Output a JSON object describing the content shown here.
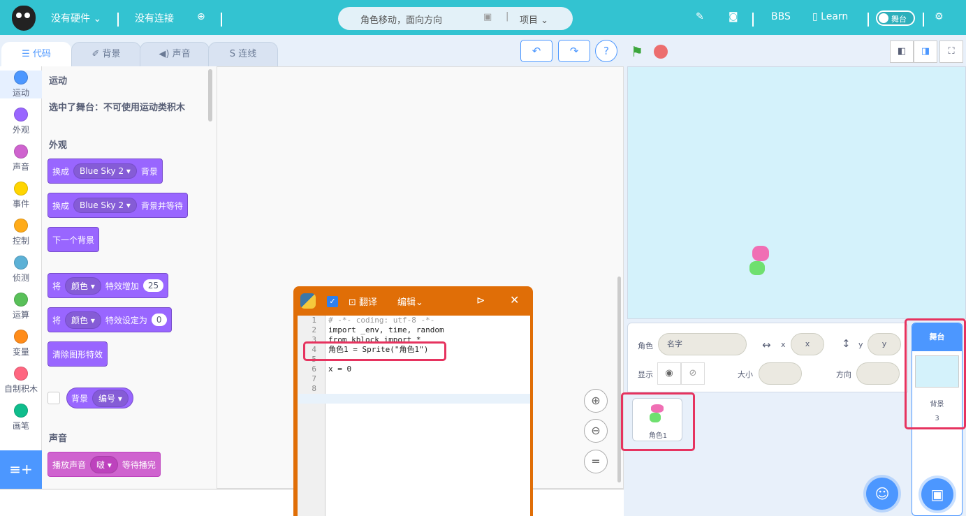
{
  "topbar": {
    "hardware": "没有硬件",
    "connection": "没有连接",
    "project_title": "角色移动，面向方向",
    "project_menu": "项目",
    "bbs": "BBS",
    "learn": "Learn",
    "stage_toggle": "舞台"
  },
  "tabs": [
    {
      "label": "代码"
    },
    {
      "label": "背景"
    },
    {
      "label": "声音"
    },
    {
      "label": "连线"
    }
  ],
  "categories": [
    {
      "label": "运动",
      "color": "#4c97ff"
    },
    {
      "label": "外观",
      "color": "#9966ff"
    },
    {
      "label": "声音",
      "color": "#cf63cf"
    },
    {
      "label": "事件",
      "color": "#ffd500"
    },
    {
      "label": "控制",
      "color": "#ffab19"
    },
    {
      "label": "侦测",
      "color": "#5cb1d6"
    },
    {
      "label": "运算",
      "color": "#59c059"
    },
    {
      "label": "变量",
      "color": "#ff8c1a"
    },
    {
      "label": "自制积木",
      "color": "#ff6680"
    },
    {
      "label": "画笔",
      "color": "#0fbd8c"
    }
  ],
  "palette": {
    "motion_heading": "运动",
    "motion_note": "选中了舞台：不可使用运动类积木",
    "looks_heading": "外观",
    "b1": {
      "a": "换成",
      "menu": "Blue Sky 2",
      "b": "背景"
    },
    "b2": {
      "a": "换成",
      "menu": "Blue Sky 2",
      "b": "背景并等待"
    },
    "b3": "下一个背景",
    "b4": {
      "a": "将",
      "menu": "颜色",
      "b": "特效增加",
      "val": "25"
    },
    "b5": {
      "a": "将",
      "menu": "颜色",
      "b": "特效设定为",
      "val": "0"
    },
    "b6": "清除图形特效",
    "b7": {
      "a": "背景",
      "menu": "编号"
    },
    "sound_heading": "声音",
    "b8": {
      "a": "播放声音",
      "menu": "啵",
      "b": "等待播完"
    }
  },
  "editor": {
    "translate": "翻译",
    "edit_menu": "编辑",
    "checked": true,
    "lines": [
      "# -*- coding: utf-8 -*-",
      "import _env, time, random",
      "from kblock import *",
      "角色1 = Sprite(\"角色1\")",
      "",
      "x = 0",
      "",
      "",
      ""
    ]
  },
  "sprite_info": {
    "sprite_label": "角色",
    "name_placeholder": "名字",
    "x_label": "x",
    "x_placeholder": "x",
    "y_label": "y",
    "y_placeholder": "y",
    "show_label": "显示",
    "size_label": "大小",
    "direction_label": "方向"
  },
  "sprites": [
    {
      "name": "角色1"
    }
  ],
  "stage_panel": {
    "title": "舞台",
    "backdrop_label": "背景",
    "backdrop_count": "3"
  },
  "colors": {
    "topbar": "#33c3d1",
    "accent": "#4c97ff",
    "editor": "#e06e07",
    "highlight": "#e6335f"
  }
}
